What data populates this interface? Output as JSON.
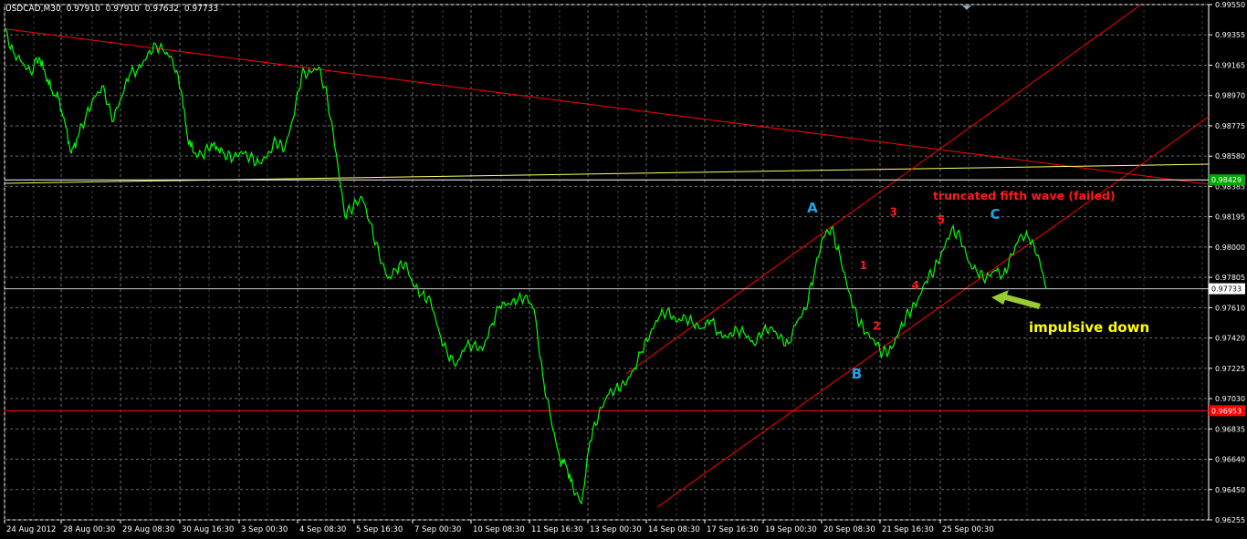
{
  "header": {
    "symbol": "USDCAD,M30",
    "open": "0.97910",
    "high": "0.97910",
    "low": "0.97632",
    "close": "0.97733"
  },
  "colors": {
    "background": "#000000",
    "grid": "#6b6b6b",
    "axis": "#ffffff",
    "price": "#00ff00",
    "trendline": "#ff0000",
    "support_line": "#ffff66",
    "label_blue": "#1fa3e6",
    "label_red": "#ff1a1a",
    "annotation_yellow": "#ffff00",
    "arrow": "#99cc33"
  },
  "chart_data": {
    "type": "line",
    "title": "",
    "xlabel": "",
    "ylabel": "",
    "ylim": [
      0.96255,
      0.9955
    ],
    "grid": true,
    "y_ticks": [
      "0.99550",
      "0.99355",
      "0.99165",
      "0.98970",
      "0.98775",
      "0.98580",
      "0.98385",
      "0.98195",
      "0.98000",
      "0.97805",
      "0.97610",
      "0.97420",
      "0.97225",
      "0.97030",
      "0.96835",
      "0.96640",
      "0.96450",
      "0.96255"
    ],
    "x_ticks": [
      "24 Aug 2012",
      "28 Aug 00:30",
      "29 Aug 08:30",
      "30 Aug 16:30",
      "3 Sep 00:30",
      "4 Sep 08:30",
      "5 Sep 16:30",
      "7 Sep 00:30",
      "10 Sep 08:30",
      "11 Sep 16:30",
      "13 Sep 00:30",
      "14 Sep 08:30",
      "17 Sep 16:30",
      "19 Sep 00:30",
      "20 Sep 08:30",
      "21 Sep 16:30",
      "25 Sep 00:30"
    ],
    "price_series": {
      "name": "USDCAD,M30",
      "x_index": [
        0,
        4,
        8,
        12,
        16,
        19,
        22,
        25,
        28,
        31,
        34,
        38,
        42,
        46,
        50,
        54,
        58,
        62,
        66,
        70,
        74,
        78,
        82,
        85,
        88,
        92,
        96,
        99,
        102,
        106,
        110,
        114,
        118,
        122,
        126,
        130,
        134,
        138,
        142,
        146,
        150,
        154,
        158,
        162,
        166,
        170,
        174,
        178,
        182,
        186,
        190,
        194,
        198,
        202,
        206,
        210,
        214,
        218,
        222,
        226,
        230,
        234,
        238,
        242,
        246,
        250,
        254,
        258,
        261,
        264,
        268,
        272,
        276,
        280,
        284,
        288,
        292,
        296,
        300,
        304,
        308,
        312,
        316,
        320
      ],
      "values": [
        0.9939,
        0.9925,
        0.9918,
        0.9912,
        0.9921,
        0.991,
        0.99,
        0.9895,
        0.988,
        0.986,
        0.987,
        0.9885,
        0.9896,
        0.9903,
        0.988,
        0.9895,
        0.991,
        0.9914,
        0.9921,
        0.993,
        0.9925,
        0.992,
        0.99,
        0.987,
        0.986,
        0.9858,
        0.9866,
        0.9862,
        0.986,
        0.9856,
        0.9861,
        0.9857,
        0.9854,
        0.9858,
        0.9868,
        0.9862,
        0.9882,
        0.991,
        0.9912,
        0.9915,
        0.9895,
        0.986,
        0.982,
        0.9826,
        0.9832,
        0.9815,
        0.9795,
        0.978,
        0.9785,
        0.979,
        0.9775,
        0.977,
        0.9765,
        0.9745,
        0.973,
        0.9725,
        0.9736,
        0.9738,
        0.9734,
        0.975,
        0.9762,
        0.9764,
        0.9765,
        0.9769,
        0.976,
        0.9718,
        0.9688,
        0.9664,
        0.966,
        0.9646,
        0.9636,
        0.9676,
        0.9693,
        0.9705,
        0.971,
        0.9712,
        0.9721,
        0.9733,
        0.9745,
        0.9755,
        0.976,
        0.9752,
        0.9756,
        0.975
      ]
    },
    "price_series_2": {
      "x_index": [
        320,
        324,
        328,
        332,
        336,
        340,
        344,
        348,
        352,
        356,
        360,
        364,
        368,
        372,
        376,
        380,
        384,
        388,
        392,
        396,
        400,
        404,
        408,
        412,
        416,
        420,
        424,
        428,
        432,
        436,
        440,
        444,
        448,
        452,
        456,
        460,
        464,
        468,
        472,
        476,
        480,
        484,
        488,
        492,
        496,
        500,
        504,
        508,
        512,
        516,
        520,
        524,
        528,
        532,
        536
      ],
      "values": [
        0.975,
        0.9748,
        0.9753,
        0.9745,
        0.9742,
        0.9748,
        0.9744,
        0.9738,
        0.9745,
        0.9749,
        0.9742,
        0.9738,
        0.9752,
        0.976,
        0.9782,
        0.9806,
        0.9812,
        0.9795,
        0.9772,
        0.9755,
        0.9745,
        0.974,
        0.9732,
        0.9735,
        0.9748,
        0.9758,
        0.9765,
        0.9778,
        0.9786,
        0.9798,
        0.9812,
        0.9806,
        0.979,
        0.9783,
        0.978,
        0.9785,
        0.9782,
        0.9795,
        0.9808,
        0.9805,
        0.9795,
        0.9773,
        0.9773,
        0.9773,
        0.9773,
        0.9773,
        0.9773,
        0.9773,
        0.9773,
        0.9773,
        0.9773,
        0.9773,
        0.9773,
        0.9773,
        0.9773
      ]
    },
    "horizontal_lines": [
      {
        "name": "support",
        "value": 0.98429,
        "label": "0.98429",
        "color": "#00aa00"
      },
      {
        "name": "current",
        "value": 0.97733,
        "label": "0.97733",
        "color": "#ffffff"
      },
      {
        "name": "red-level",
        "value": 0.96953,
        "label": "0.96953",
        "color": "#ff0000"
      }
    ],
    "wave_labels": [
      {
        "text": "A",
        "color": "blue",
        "x": 0.6665,
        "y": 0.9822
      },
      {
        "text": "B",
        "color": "blue",
        "x": 0.7034,
        "y": 0.9716
      },
      {
        "text": "C",
        "color": "blue",
        "x": 0.8185,
        "y": 0.9818
      },
      {
        "text": "1",
        "color": "red",
        "x": 0.7101,
        "y": 0.9786
      },
      {
        "text": "2",
        "color": "red",
        "x": 0.721,
        "y": 0.9747
      },
      {
        "text": "3",
        "color": "red",
        "x": 0.735,
        "y": 0.982
      },
      {
        "text": "4",
        "color": "red",
        "x": 0.7533,
        "y": 0.9773
      },
      {
        "text": "5",
        "color": "red",
        "x": 0.7745,
        "y": 0.9815
      }
    ],
    "annotations": [
      {
        "text": "truncated fifth wave (failed)",
        "color": "red"
      },
      {
        "text": "impulsive down",
        "color": "yellow"
      }
    ]
  }
}
